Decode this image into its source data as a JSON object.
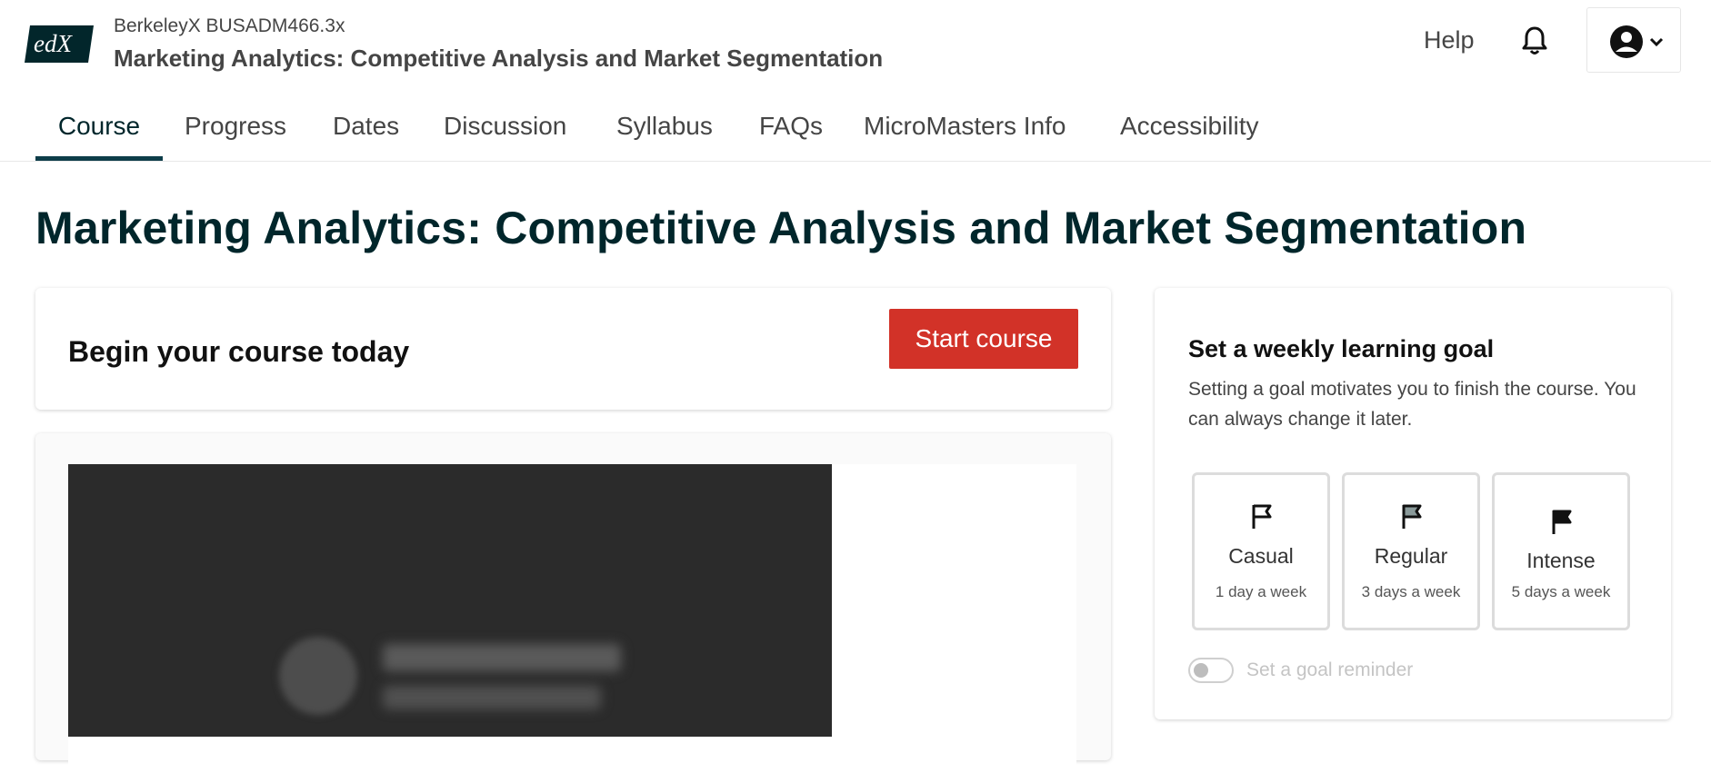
{
  "header": {
    "logo_text": "edX",
    "course_org": "BerkeleyX BUSADM466.3x",
    "course_name": "Marketing Analytics: Competitive Analysis and Market Segmentation",
    "help_label": "Help",
    "notifications_icon": "bell-icon",
    "user_icon": "account-circle-icon"
  },
  "tabs": [
    {
      "label": "Course",
      "active": true
    },
    {
      "label": "Progress"
    },
    {
      "label": "Dates"
    },
    {
      "label": "Discussion"
    },
    {
      "label": "Syllabus"
    },
    {
      "label": "FAQs"
    },
    {
      "label": "MicroMasters Info"
    },
    {
      "label": "Accessibility"
    }
  ],
  "page_title": "Marketing Analytics: Competitive Analysis and Market Segmentation",
  "begin": {
    "title": "Begin your course today",
    "button": "Start course"
  },
  "goal": {
    "title": "Set a weekly learning goal",
    "description": "Setting a goal motivates you to finish the course. You can always change it later.",
    "options": [
      {
        "name": "Casual",
        "frequency": "1 day a week",
        "icon": "flag-outline-icon"
      },
      {
        "name": "Regular",
        "frequency": "3 days a week",
        "icon": "flag-half-icon"
      },
      {
        "name": "Intense",
        "frequency": "5 days a week",
        "icon": "flag-filled-icon"
      }
    ],
    "reminder_label": "Set a goal reminder",
    "reminder_on": false
  },
  "colors": {
    "brand_dark": "#00262b",
    "tab_indicator": "#0d3d49",
    "start_button": "#d23228"
  }
}
